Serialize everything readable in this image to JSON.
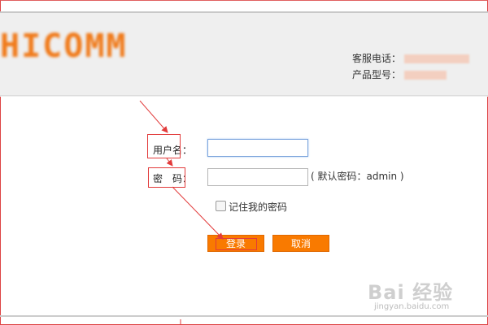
{
  "header": {
    "logo_text": "HICOMM",
    "contact_phone_label": "客服电话：",
    "product_model_label": "产品型号："
  },
  "form": {
    "username_label": "用户名：",
    "username_value": "",
    "password_label": "密　码：",
    "password_value": "",
    "password_hint": "( 默认密码：admin )",
    "remember_label": "记住我的密码",
    "remember_checked": false,
    "login_label": "登录",
    "cancel_label": "取消"
  },
  "watermark": {
    "brand": "Bai 经验",
    "url": "jingyan.baidu.com"
  },
  "colors": {
    "accent": "#f97a00",
    "logo": "#f07a1a",
    "annotation": "#e23b3b",
    "focus_border": "#7ea6dd"
  }
}
